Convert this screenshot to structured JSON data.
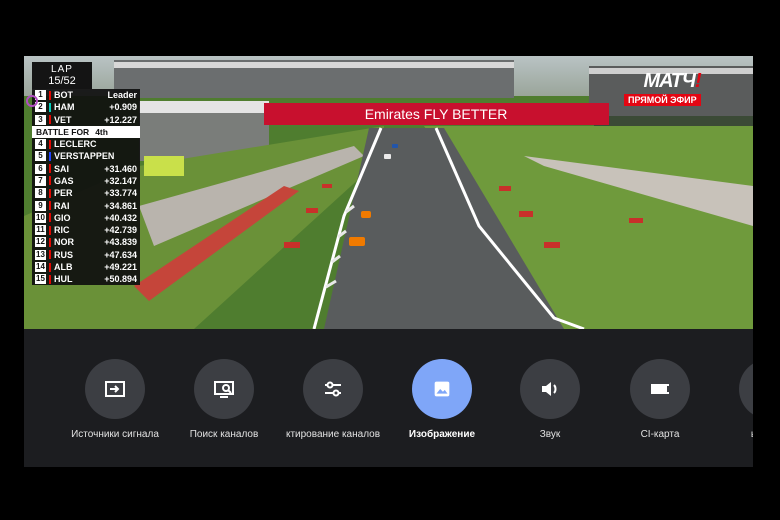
{
  "leaderboard": {
    "lap_title": "LAP",
    "lap_value": "15/52",
    "battle_label": "BATTLE FOR",
    "battle_position": "4th",
    "top": [
      {
        "pos": "1",
        "driver": "BOT",
        "gap": "Leader"
      },
      {
        "pos": "2",
        "driver": "HAM",
        "gap": "+0.909"
      },
      {
        "pos": "3",
        "driver": "VET",
        "gap": "+12.227"
      }
    ],
    "battle": [
      {
        "pos": "4",
        "driver": "LECLERC"
      },
      {
        "pos": "5",
        "driver": "VERSTAPPEN"
      }
    ],
    "rest": [
      {
        "pos": "6",
        "driver": "SAI",
        "gap": "+31.460"
      },
      {
        "pos": "7",
        "driver": "GAS",
        "gap": "+32.147"
      },
      {
        "pos": "8",
        "driver": "PER",
        "gap": "+33.774"
      },
      {
        "pos": "9",
        "driver": "RAI",
        "gap": "+34.861"
      },
      {
        "pos": "10",
        "driver": "GIO",
        "gap": "+40.432"
      },
      {
        "pos": "11",
        "driver": "RIC",
        "gap": "+42.739"
      },
      {
        "pos": "12",
        "driver": "NOR",
        "gap": "+43.839"
      },
      {
        "pos": "13",
        "driver": "RUS",
        "gap": "+47.634"
      },
      {
        "pos": "14",
        "driver": "ALB",
        "gap": "+49.221"
      },
      {
        "pos": "15",
        "driver": "HUL",
        "gap": "+50.894"
      }
    ]
  },
  "channel": {
    "brand": "МАТЧ",
    "brand_mark": "!",
    "live": "ПРЯМОЙ ЭФИР"
  },
  "banner": {
    "text": "Emirates FLY BETTER"
  },
  "menu": {
    "items": [
      {
        "label": "Источники сигнала",
        "icon": "input-source-icon",
        "active": false
      },
      {
        "label": "Поиск каналов",
        "icon": "channel-search-icon",
        "active": false
      },
      {
        "label": "ктирование каналов",
        "icon": "sliders-icon",
        "active": false
      },
      {
        "label": "Изображение",
        "icon": "picture-icon",
        "active": true
      },
      {
        "label": "Звук",
        "icon": "speaker-icon",
        "active": false
      },
      {
        "label": "CI-карта",
        "icon": "ci-card-icon",
        "active": false
      },
      {
        "label": "ые наст",
        "icon": "settings-icon",
        "active": false
      }
    ]
  },
  "colors": {
    "accent": "#7fa6f8",
    "menu_bg": "#1c1d20",
    "circle": "#3c3e43",
    "f1_red": "#e10600",
    "live_red": "#e30613"
  }
}
